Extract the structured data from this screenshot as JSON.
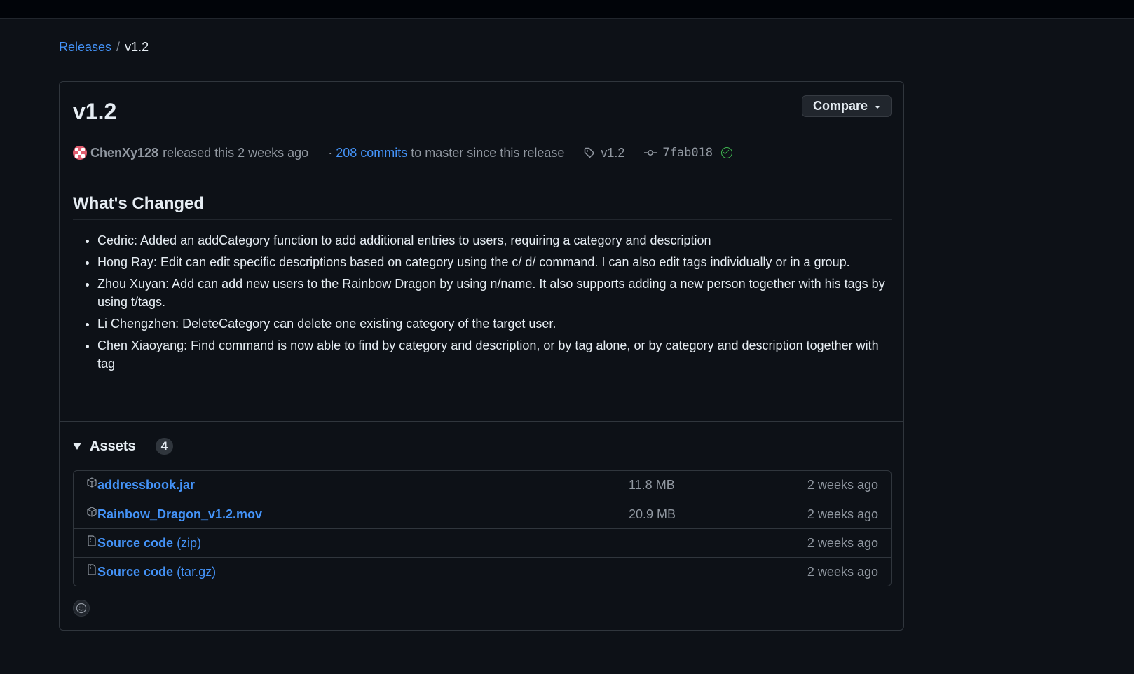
{
  "breadcrumb": {
    "root": "Releases",
    "separator": "/",
    "current": "v1.2"
  },
  "release": {
    "title": "v1.2",
    "compare_label": "Compare",
    "author": "ChenXy128",
    "released_text": "released this 2 weeks ago",
    "commits_prefix": "·",
    "commits_link": "208 commits",
    "commits_suffix": "to master since this release",
    "tag": "v1.2",
    "commit_sha": "7fab018"
  },
  "changes": {
    "heading": "What's Changed",
    "items": [
      "Cedric: Added an addCategory function to add additional entries to users, requiring a category and description",
      "Hong Ray: Edit can edit specific descriptions based on category using the c/ d/ command. I can also edit tags individually or in a group.",
      "Zhou Xuyan: Add can add new users to the Rainbow Dragon by using n/name. It also supports adding a new person together with his tags by using t/tags.",
      "Li Chengzhen: DeleteCategory can delete one existing category of the target user.",
      "Chen Xiaoyang: Find command is now able to find by category and description, or by tag alone, or by category and description together with tag"
    ]
  },
  "assets": {
    "label": "Assets",
    "count": "4",
    "items": [
      {
        "name": "addressbook.jar",
        "suffix": "",
        "size": "11.8 MB",
        "date": "2 weeks ago",
        "icon": "package-icon"
      },
      {
        "name": "Rainbow_Dragon_v1.2.mov",
        "suffix": "",
        "size": "20.9 MB",
        "date": "2 weeks ago",
        "icon": "package-icon"
      },
      {
        "name": "Source code",
        "suffix": "(zip)",
        "size": "",
        "date": "2 weeks ago",
        "icon": "file-zip-icon"
      },
      {
        "name": "Source code",
        "suffix": "(tar.gz)",
        "size": "",
        "date": "2 weeks ago",
        "icon": "file-zip-icon"
      }
    ]
  },
  "colors": {
    "background": "#0d1117",
    "accent": "#4493f8",
    "border": "#30363d",
    "muted": "#9198a1",
    "success": "#3fb950"
  }
}
